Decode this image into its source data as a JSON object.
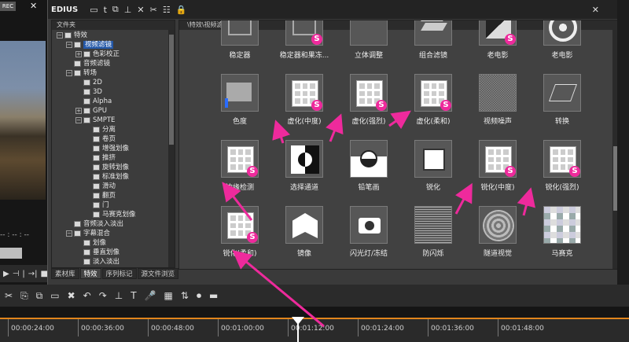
{
  "left_panel": {
    "rec_label": "REC",
    "close_glyph": "✕",
    "timecode_dashes": "-- : -- : --",
    "controls": [
      "▶",
      "⊣",
      "|",
      "→|",
      "■"
    ]
  },
  "app": {
    "title": "EDIUS",
    "toolbar_icons": [
      "folder-icon",
      "text-icon",
      "copy-icon",
      "import-icon",
      "delete-icon",
      "cut-icon",
      "grid-icon",
      "lock-icon"
    ],
    "close_glyph": "✕"
  },
  "folder_pane": {
    "header": "文件夹",
    "items": [
      {
        "label": "特效",
        "level": 0,
        "toggle": "−"
      },
      {
        "label": "视频滤镜",
        "level": 1,
        "toggle": "−",
        "selected": true
      },
      {
        "label": "色彩校正",
        "level": 2,
        "toggle": "+"
      },
      {
        "label": "音频滤镜",
        "level": 1,
        "toggle": ""
      },
      {
        "label": "转场",
        "level": 1,
        "toggle": "−"
      },
      {
        "label": "2D",
        "level": 2,
        "toggle": ""
      },
      {
        "label": "3D",
        "level": 2,
        "toggle": ""
      },
      {
        "label": "Alpha",
        "level": 2,
        "toggle": ""
      },
      {
        "label": "GPU",
        "level": 2,
        "toggle": "+"
      },
      {
        "label": "SMPTE",
        "level": 2,
        "toggle": "−"
      },
      {
        "label": "分离",
        "level": 3,
        "toggle": ""
      },
      {
        "label": "卷页",
        "level": 3,
        "toggle": ""
      },
      {
        "label": "增强划像",
        "level": 3,
        "toggle": ""
      },
      {
        "label": "推挤",
        "level": 3,
        "toggle": ""
      },
      {
        "label": "旋转划像",
        "level": 3,
        "toggle": ""
      },
      {
        "label": "标准划像",
        "level": 3,
        "toggle": ""
      },
      {
        "label": "滑动",
        "level": 3,
        "toggle": ""
      },
      {
        "label": "翻页",
        "level": 3,
        "toggle": ""
      },
      {
        "label": "门",
        "level": 3,
        "toggle": ""
      },
      {
        "label": "马赛克划像",
        "level": 3,
        "toggle": ""
      },
      {
        "label": "音频淡入淡出",
        "level": 1,
        "toggle": ""
      },
      {
        "label": "字幕混合",
        "level": 1,
        "toggle": "−"
      },
      {
        "label": "划像",
        "level": 2,
        "toggle": ""
      },
      {
        "label": "垂直划像",
        "level": 2,
        "toggle": ""
      },
      {
        "label": "淡入淡出",
        "level": 2,
        "toggle": ""
      }
    ]
  },
  "tabs": [
    {
      "label": "素材库",
      "active": false
    },
    {
      "label": "特效",
      "active": true
    },
    {
      "label": "序列标记",
      "active": false
    },
    {
      "label": "源文件浏览",
      "active": false
    }
  ],
  "effects_pane": {
    "path": "\\特效\\视频滤镜\\",
    "rows": [
      [
        {
          "label": "稳定器",
          "icon": "stabilizer-icon",
          "badge": ""
        },
        {
          "label": "稳定器和果冻...",
          "icon": "stabilizer-icon",
          "badge": "S"
        },
        {
          "label": "立体调整",
          "icon": "3d-icon",
          "badge": ""
        },
        {
          "label": "组合滤镜",
          "icon": "layers-icon",
          "badge": ""
        },
        {
          "label": "老电影",
          "icon": "old-film-icon",
          "badge": "S"
        },
        {
          "label": "老电影",
          "icon": "film-reel-icon",
          "badge": ""
        }
      ],
      [
        {
          "label": "色度",
          "icon": "chroma-icon",
          "badge": ""
        },
        {
          "label": "虚化(中度)",
          "icon": "grid-icon",
          "badge": "S"
        },
        {
          "label": "虚化(强烈)",
          "icon": "grid-icon",
          "badge": "S"
        },
        {
          "label": "虚化(柔和)",
          "icon": "grid-icon",
          "badge": "S"
        },
        {
          "label": "视频噪声",
          "icon": "noise-icon",
          "badge": ""
        },
        {
          "label": "转换",
          "icon": "transform-icon",
          "badge": ""
        }
      ],
      [
        {
          "label": "边缘检测",
          "icon": "grid-icon",
          "badge": "S"
        },
        {
          "label": "选择通道",
          "icon": "channel-icon",
          "badge": ""
        },
        {
          "label": "铅笔画",
          "icon": "pencil-icon",
          "badge": ""
        },
        {
          "label": "锐化",
          "icon": "sharpen-icon",
          "badge": ""
        },
        {
          "label": "锐化(中度)",
          "icon": "grid-icon",
          "badge": "S"
        },
        {
          "label": "锐化(强烈)",
          "icon": "grid-icon",
          "badge": "S"
        }
      ],
      [
        {
          "label": "锐化(柔和)",
          "icon": "grid-icon",
          "badge": "S"
        },
        {
          "label": "镜像",
          "icon": "mirror-icon",
          "badge": ""
        },
        {
          "label": "闪光灯/冻结",
          "icon": "camera-icon",
          "badge": ""
        },
        {
          "label": "防闪烁",
          "icon": "lines-icon",
          "badge": ""
        },
        {
          "label": "隧道视觉",
          "icon": "tunnel-icon",
          "badge": ""
        },
        {
          "label": "马赛克",
          "icon": "mosaic-icon",
          "badge": ""
        }
      ]
    ]
  },
  "timeline": {
    "tools": [
      "✂",
      "⎘",
      "⧉",
      "▭",
      "✖",
      "↶",
      "↷",
      "⊥",
      "T",
      "🎤",
      "▦",
      "⇅",
      "⏺",
      "▬"
    ],
    "timecodes": [
      "00:00:24:00",
      "00:00:36:00",
      "00:00:48:00",
      "00:01:00:00",
      "00:01:12:00",
      "00:01:24:00",
      "00:01:36:00",
      "00:01:48:00"
    ]
  },
  "colors": {
    "accent": "#ee2a9c",
    "selection": "#2458a8",
    "playhead_marker": "#e0851c"
  }
}
